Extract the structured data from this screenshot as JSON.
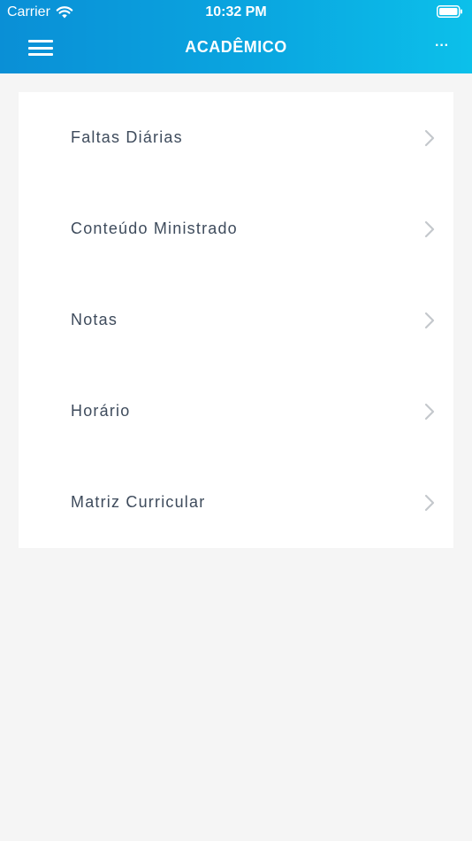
{
  "status_bar": {
    "carrier": "Carrier",
    "time": "10:32 PM"
  },
  "header": {
    "title": "ACADÊMICO",
    "menu_icon": "hamburger-menu-icon",
    "more_icon": "ellipsis-icon",
    "more_label": "···"
  },
  "menu": {
    "items": [
      {
        "label": "Faltas Diárias"
      },
      {
        "label": "Conteúdo Ministrado"
      },
      {
        "label": "Notas"
      },
      {
        "label": "Horário"
      },
      {
        "label": "Matriz Curricular"
      }
    ]
  },
  "colors": {
    "header_start": "#0a8fd6",
    "header_end": "#0cc0ea",
    "item_text": "#3e4b5c",
    "chevron": "#c4c8cc",
    "background": "#f5f5f5"
  }
}
